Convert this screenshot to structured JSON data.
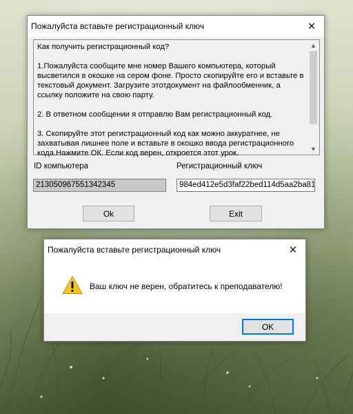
{
  "main_dialog": {
    "title": "Пожалуйста вставьте регистрационный ключ",
    "close_glyph": "✕",
    "instructions": [
      "Как получить регистрационный код?",
      "1.Пожалуйста сообщите мне номер Вашего компьютера, который\nвысветился в окошке на сером фоне. Просто скопируйте его и вставьте в\nтекстовый документ. Загрузите этотдокумент на файлообменник, а\nссылку положите на свою парту.",
      "2. В ответном сообщении я отправлю Вам регистрационный код.",
      "3. Скопируйте этот регистрационный код как можно аккуратнее, не\nзахватывая лишнее поле и вставьте в окошко ввода регистрационного\nкода.Нажмите ОК. Если код верен, откроется этот урок."
    ],
    "computer_id_label": "ID компьютера",
    "computer_id_value": "213050967551342345",
    "reg_key_label": "Регистрационный ключ",
    "reg_key_value": "984ed412e5d3faf22bed114d5aa2ba81",
    "ok_label": "Ok",
    "exit_label": "Exit"
  },
  "error_dialog": {
    "title": "Пожалуйста вставьте регистрационный ключ",
    "close_glyph": "✕",
    "icon": "warning-icon",
    "message": "Ваш ключ не верен, обратитесь к преподавателю!",
    "ok_label": "OK"
  },
  "colors": {
    "accent": "#0078d7",
    "dialog_bg": "#f0f0f0",
    "readonly_field_bg": "#c8c8c8",
    "warning_yellow": "#f5c518"
  }
}
